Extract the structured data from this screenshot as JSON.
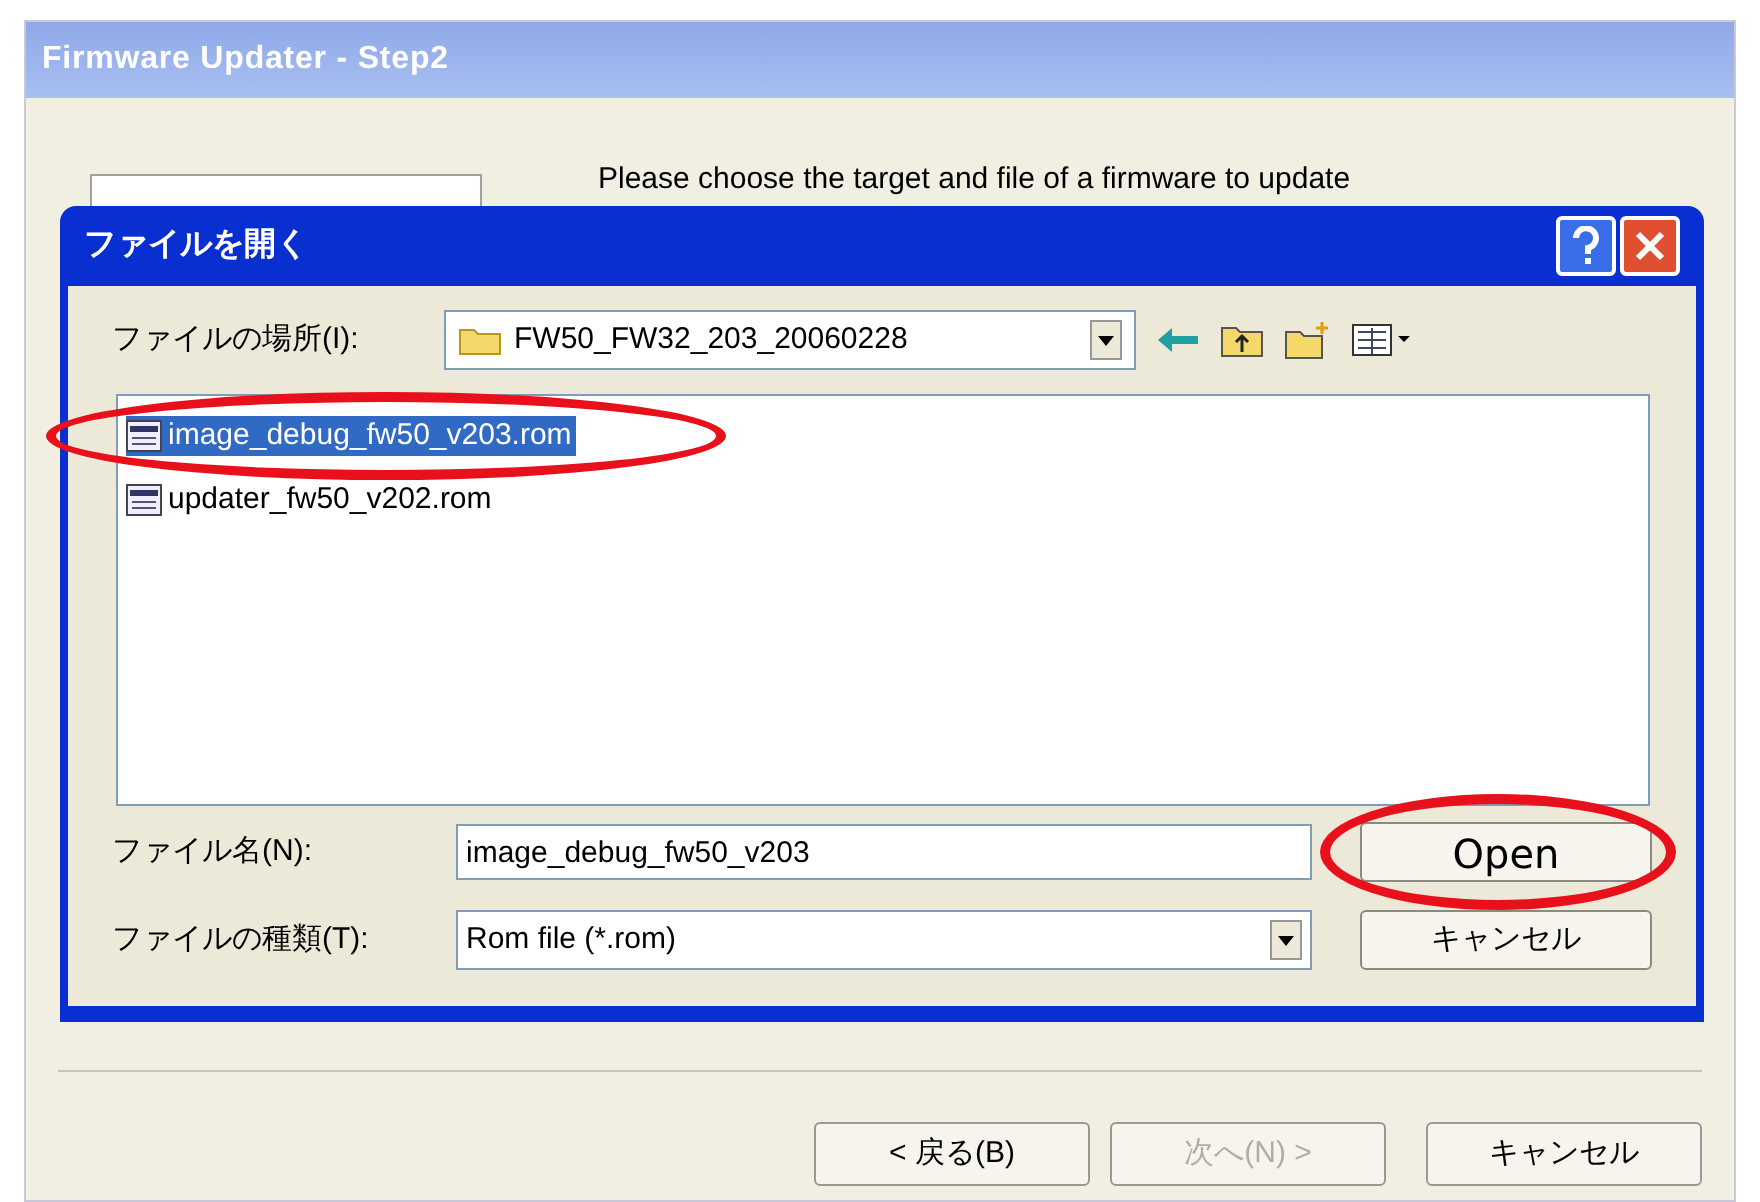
{
  "window": {
    "title": "Firmware Updater - Step2"
  },
  "instruction": "Please choose the target and file of a firmware to update",
  "dialog": {
    "title": "ファイルを開く",
    "location": {
      "label": "ファイルの場所(I):",
      "value": "FW50_FW32_203_20060228"
    },
    "files": [
      {
        "name": "image_debug_fw50_v203.rom",
        "selected": true,
        "highlighted": true
      },
      {
        "name": "updater_fw50_v202.rom",
        "selected": false,
        "highlighted": false
      }
    ],
    "file_name": {
      "label": "ファイル名(N):",
      "value": "image_debug_fw50_v203"
    },
    "file_type": {
      "label": "ファイルの種類(T):",
      "value": "Rom file (*.rom)"
    },
    "buttons": [
      {
        "label": "Open",
        "highlighted": true
      },
      {
        "label": "キャンセル",
        "highlighted": false
      }
    ]
  },
  "buttons": [
    {
      "label": "< 戻る(B)",
      "disabled": false
    },
    {
      "label": "次へ(N) >",
      "disabled": true
    },
    {
      "label": "キャンセル",
      "disabled": false
    }
  ]
}
